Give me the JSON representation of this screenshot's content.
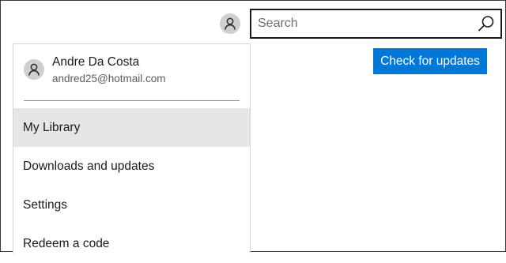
{
  "header": {
    "avatar_icon": "user-icon",
    "search": {
      "placeholder": "Search",
      "value": "",
      "icon": "search-icon"
    }
  },
  "main": {
    "check_updates_label": "Check for updates",
    "accent_color": "#0078d7"
  },
  "account_menu": {
    "user_name": "Andre Da Costa",
    "user_email": "andred25@hotmail.com",
    "avatar_icon": "user-icon",
    "items": [
      {
        "label": "My Library",
        "selected": true
      },
      {
        "label": "Downloads and updates",
        "selected": false
      },
      {
        "label": "Settings",
        "selected": false
      },
      {
        "label": "Redeem a code",
        "selected": false
      }
    ]
  }
}
